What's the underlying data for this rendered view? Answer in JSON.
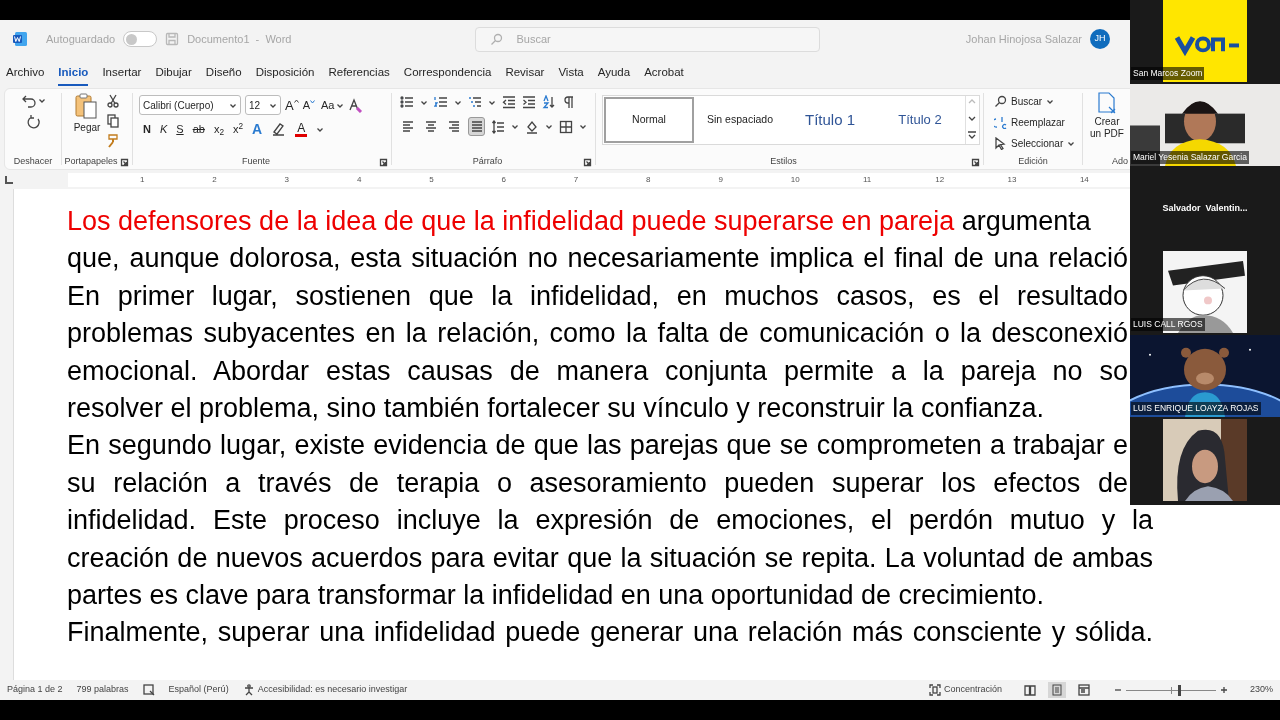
{
  "title_bar": {
    "autosave_label": "Autoguardado",
    "autosave_on": false,
    "document_title": "Documento1  -  Word",
    "search": {
      "placeholder": "Buscar"
    },
    "user_name": "Johan Hinojosa Salazar",
    "user_initials": "JH"
  },
  "menu_tabs": [
    {
      "label": "Archivo",
      "selected": false
    },
    {
      "label": "Inicio",
      "selected": true
    },
    {
      "label": "Insertar",
      "selected": false
    },
    {
      "label": "Dibujar",
      "selected": false
    },
    {
      "label": "Diseño",
      "selected": false
    },
    {
      "label": "Disposición",
      "selected": false
    },
    {
      "label": "Referencias",
      "selected": false
    },
    {
      "label": "Correspondencia",
      "selected": false
    },
    {
      "label": "Revisar",
      "selected": false
    },
    {
      "label": "Vista",
      "selected": false
    },
    {
      "label": "Ayuda",
      "selected": false
    },
    {
      "label": "Acrobat",
      "selected": false
    }
  ],
  "ribbon": {
    "undo_group": {
      "label": "Deshacer"
    },
    "clipboard_group": {
      "label": "Portapapeles",
      "paste": "Pegar"
    },
    "font_group": {
      "label": "Fuente",
      "font_name": "Calibri (Cuerpo)",
      "font_size": "12",
      "size_buttons": [
        "A",
        "A"
      ],
      "case_button": "Aa",
      "format_buttons": [
        "N",
        "K",
        "S",
        "ab",
        "x$_{2}$",
        "x$^{2}$"
      ],
      "effect_button": "A",
      "color_button": "A"
    },
    "paragraph_group": {
      "label": "Párrafo",
      "alignments": [
        {
          "kind": "left",
          "selected": false
        },
        {
          "kind": "center",
          "selected": false
        },
        {
          "kind": "right",
          "selected": false
        },
        {
          "kind": "justify",
          "selected": true
        }
      ]
    },
    "styles_group": {
      "label": "Estilos",
      "styles": [
        {
          "label": "Normal",
          "kind": "body",
          "selected": true
        },
        {
          "label": "Sin espaciado",
          "kind": "body",
          "selected": false
        },
        {
          "label": "Título 1",
          "kind": "heading1",
          "selected": false
        },
        {
          "label": "Título 2",
          "kind": "heading2",
          "selected": false
        }
      ]
    },
    "editing_group": {
      "label": "Edición",
      "items": [
        {
          "label": "Buscar",
          "kind": "search"
        },
        {
          "label": "Reemplazar",
          "kind": "replace"
        },
        {
          "label": "Seleccionar",
          "kind": "select"
        }
      ]
    },
    "adobe_group": {
      "label": "Ado",
      "button": "Crear un PDF"
    }
  },
  "ruler": {
    "numbers": [
      "1",
      "2",
      "3",
      "4",
      "5",
      "6",
      "7",
      "8",
      "9",
      "10",
      "11",
      "12",
      "13",
      "14"
    ]
  },
  "document": {
    "lines": [
      {
        "segments": [
          {
            "text": "Los defensores de la idea de que la infidelidad puede superarse en pareja",
            "color": "#ee0000"
          },
          {
            "text": " argumenta",
            "color": "#000000"
          }
        ],
        "justified": false
      },
      {
        "segments": [
          {
            "text": "que, aunque dolorosa, esta situación no necesariamente implica el final de una relació",
            "color": "#000000"
          }
        ],
        "justified": true,
        "clipped": true
      },
      {
        "segments": [
          {
            "text": "En primer lugar, sostienen que la infidelidad, en muchos casos, es el resultado",
            "color": "#000000"
          }
        ],
        "justified": true,
        "clipped": true
      },
      {
        "segments": [
          {
            "text": "problemas subyacentes en la relación, como la falta de comunicación o la desconexió",
            "color": "#000000"
          }
        ],
        "justified": true,
        "clipped": true
      },
      {
        "segments": [
          {
            "text": "emocional. Abordar estas causas de manera conjunta permite a la pareja no so",
            "color": "#000000"
          }
        ],
        "justified": true,
        "clipped": true
      },
      {
        "segments": [
          {
            "text": "resolver el problema, sino también fortalecer su vínculo y reconstruir la confianza.",
            "color": "#000000"
          }
        ],
        "justified": false
      },
      {
        "segments": [
          {
            "text": "En segundo lugar, existe evidencia de que las parejas que se comprometen a trabajar e",
            "color": "#000000"
          }
        ],
        "justified": true,
        "clipped": true
      },
      {
        "segments": [
          {
            "text": "su relación a través de terapia o asesoramiento pueden superar los efectos de",
            "color": "#000000"
          }
        ],
        "justified": true,
        "clipped": true
      },
      {
        "segments": [
          {
            "text": "infidelidad. Este proceso incluye la expresión de emociones, el perdón mutuo y la",
            "color": "#000000"
          }
        ],
        "justified": true,
        "clipped": false
      },
      {
        "segments": [
          {
            "text": "creación de nuevos acuerdos para evitar que la situación se repita. La voluntad de ambas",
            "color": "#000000"
          }
        ],
        "justified": true,
        "clipped": false
      },
      {
        "segments": [
          {
            "text": "partes es clave para transformar la infidelidad en una oportunidad de crecimiento.",
            "color": "#000000"
          }
        ],
        "justified": false
      },
      {
        "segments": [
          {
            "text": "Finalmente, superar una infidelidad puede generar una relación más consciente y sólida.",
            "color": "#000000"
          }
        ],
        "justified": true,
        "clipped": false
      }
    ]
  },
  "status_bar": {
    "page": "Página 1 de 2",
    "words": "799 palabras",
    "language": "Español (Perú)",
    "accessibility": "Accesibilidad: es necesario investigar",
    "focus": "Concentración",
    "zoom_slider": {
      "level": 0.6
    },
    "zoom": "230%"
  },
  "participants": [
    {
      "kind": "square",
      "name": "San Marcos Zoom"
    },
    {
      "kind": "wide",
      "name": "Mariel Yesenia Salazar Garcia"
    },
    {
      "kind": "name_only",
      "name": "Salvador  Valentin..."
    },
    {
      "kind": "square",
      "name": "LUIS CALL RGOS"
    },
    {
      "kind": "wide",
      "name": "LUIS ENRIQUE LOAYZA ROJAS"
    },
    {
      "kind": "square"
    }
  ]
}
